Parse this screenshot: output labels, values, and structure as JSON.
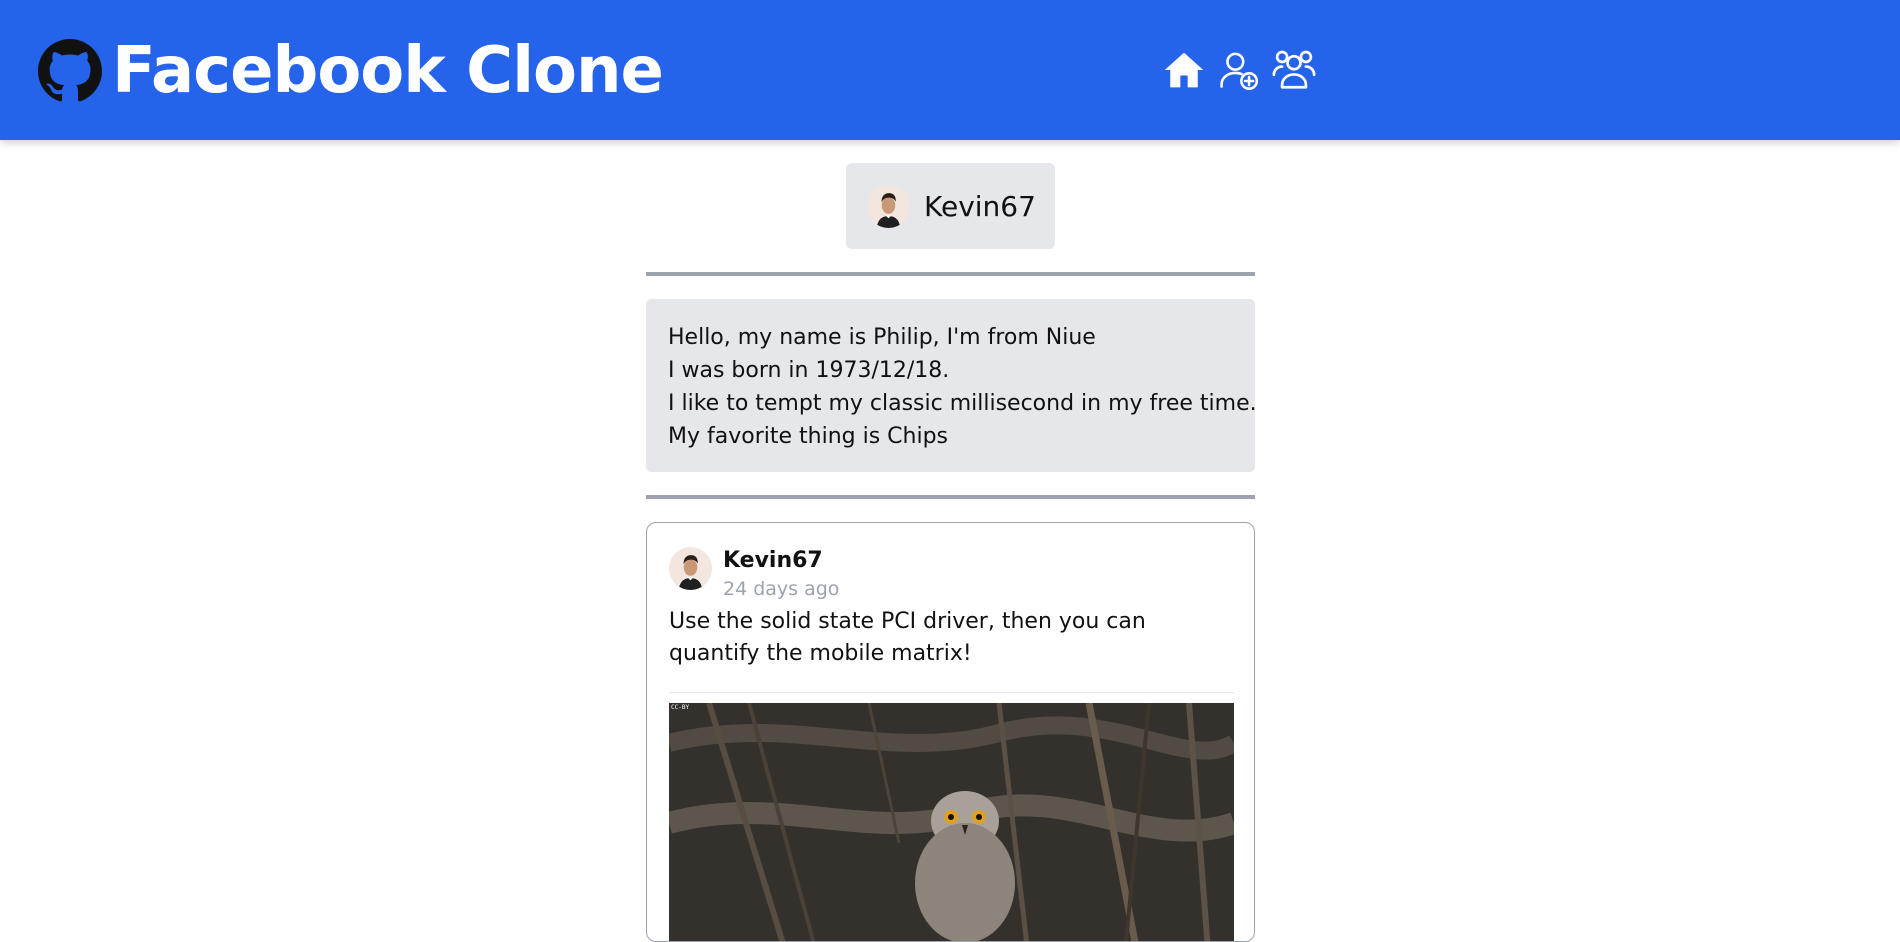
{
  "header": {
    "app_title": "Facebook Clone",
    "brand_icon": "github-icon",
    "background_color": "#2563eb",
    "nav": [
      {
        "name": "home",
        "icon": "home-icon"
      },
      {
        "name": "add-friend",
        "icon": "user-plus-icon"
      },
      {
        "name": "friends",
        "icon": "users-icon"
      }
    ]
  },
  "profile": {
    "username": "Kevin67",
    "avatar_icon": "user-avatar"
  },
  "about": {
    "lines": [
      "Hello, my name is Philip, I'm from Niue",
      "I was born in 1973/12/18.",
      "I like to tempt my classic millisecond in my free time.",
      "My favorite thing is Chips"
    ]
  },
  "post": {
    "author": "Kevin67",
    "time": "24 days ago",
    "text": "Use the solid state PCI driver, then you can quantify the mobile matrix!",
    "image_label": "CC-BY",
    "image_subject": "owl photo"
  },
  "colors": {
    "accent": "#2563eb",
    "panel": "#e5e7eb",
    "divider": "#9ca3af",
    "muted_text": "#9ca3af"
  }
}
